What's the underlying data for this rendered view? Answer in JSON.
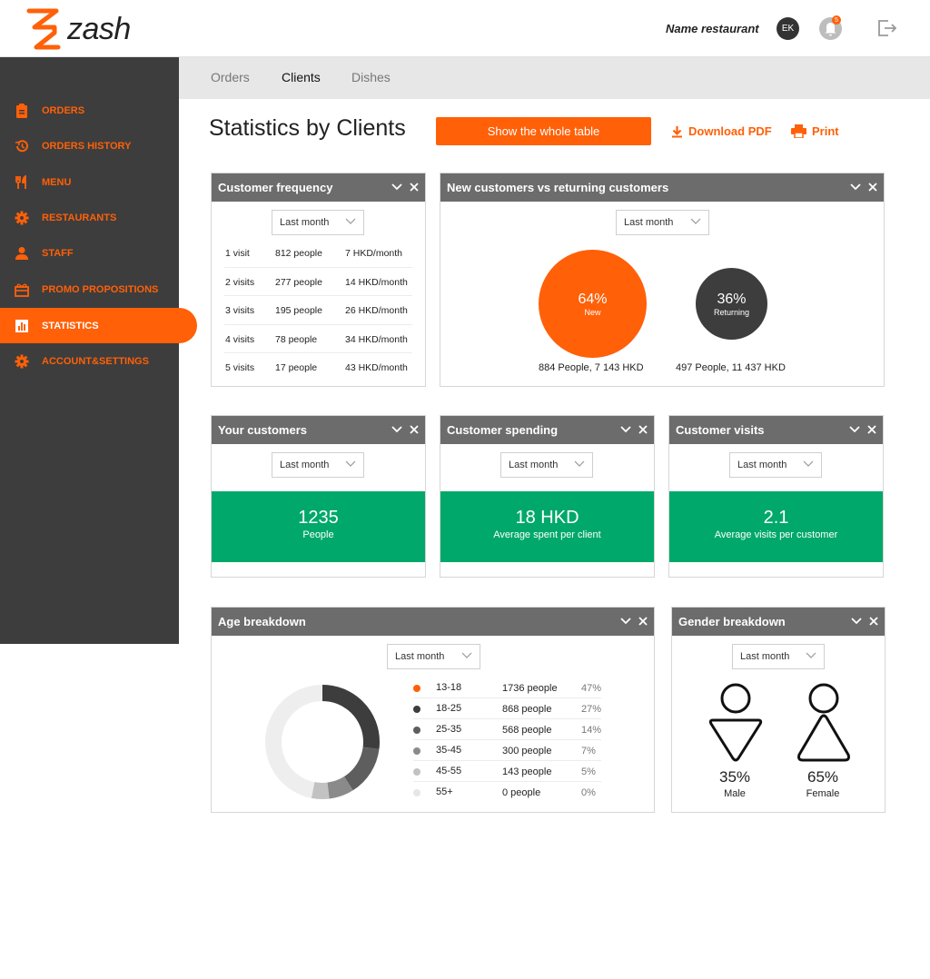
{
  "header": {
    "logo_text": "zash",
    "restaurant_name": "Name restaurant",
    "avatar_initials": "EK",
    "notification_count": "5"
  },
  "sidebar": {
    "items": [
      {
        "label": "ORDERS",
        "icon": "clipboard-icon"
      },
      {
        "label": "ORDERS HISTORY",
        "icon": "history-icon"
      },
      {
        "label": "MENU",
        "icon": "cutlery-icon"
      },
      {
        "label": "RESTAURANTS",
        "icon": "gear-icon"
      },
      {
        "label": "STAFF",
        "icon": "person-icon"
      },
      {
        "label": "PROMO PROPOSITIONS",
        "icon": "gift-icon"
      },
      {
        "label": "STATISTICS",
        "icon": "chart-icon",
        "active": true
      },
      {
        "label": "ACCOUNT&SETTINGS",
        "icon": "gear-icon"
      }
    ]
  },
  "tabs": [
    "Orders",
    "Clients",
    "Dishes"
  ],
  "active_tab": "Clients",
  "page": {
    "title": "Statistics by Clients",
    "show_table_label": "Show the whole table",
    "download_label": "Download PDF",
    "print_label": "Print"
  },
  "colors": {
    "accent": "#ff6008",
    "dark": "#3d3d3d",
    "green": "#00a86b",
    "card_head": "#6c6c6c"
  },
  "frequency": {
    "title": "Customer frequency",
    "period": "Last month",
    "rows": [
      {
        "visits": "1 visit",
        "people": "812 people",
        "spend": "7 HKD/month"
      },
      {
        "visits": "2 visits",
        "people": "277 people",
        "spend": "14 HKD/month"
      },
      {
        "visits": "3 visits",
        "people": "195 people",
        "spend": "26 HKD/month"
      },
      {
        "visits": "4 visits",
        "people": "78 people",
        "spend": "34 HKD/month"
      },
      {
        "visits": "5 visits",
        "people": "17 people",
        "spend": "43 HKD/month"
      }
    ]
  },
  "new_vs_returning": {
    "title": "New customers vs returning customers",
    "period": "Last month",
    "new": {
      "pct": "64%",
      "label": "New",
      "caption": "884 People, 7 143 HKD"
    },
    "returning": {
      "pct": "36%",
      "label": "Returning",
      "caption": "497 People, 11 437 HKD"
    }
  },
  "your_customers": {
    "title": "Your customers",
    "period": "Last month",
    "value": "1235",
    "sub": "People"
  },
  "customer_spending": {
    "title": "Customer spending",
    "period": "Last month",
    "value": "18 HKD",
    "sub": "Average spent per client"
  },
  "customer_visits": {
    "title": "Customer visits",
    "period": "Last month",
    "value": "2.1",
    "sub": "Average visits per customer"
  },
  "age": {
    "title": "Age breakdown",
    "period": "Last month",
    "rows": [
      {
        "range": "13-18",
        "people": "1736 people",
        "pct": "47%",
        "color": "#ff6008"
      },
      {
        "range": "18-25",
        "people": "868 people",
        "pct": "27%",
        "color": "#3d3d3d"
      },
      {
        "range": "25-35",
        "people": "568 people",
        "pct": "14%",
        "color": "#5e5e5e"
      },
      {
        "range": "35-45",
        "people": "300 people",
        "pct": "7%",
        "color": "#8a8a8a"
      },
      {
        "range": "45-55",
        "people": "143 people",
        "pct": "5%",
        "color": "#c2c2c2"
      },
      {
        "range": "55+",
        "people": "0 people",
        "pct": "0%",
        "color": "#e6e6e6"
      }
    ]
  },
  "chart_data": {
    "type": "pie",
    "categories": [
      "13-18",
      "18-25",
      "25-35",
      "35-45",
      "45-55",
      "55+"
    ],
    "values": [
      47,
      27,
      14,
      7,
      5,
      0
    ],
    "title": ""
  },
  "gender": {
    "title": "Gender breakdown",
    "period": "Last month",
    "male": {
      "pct": "35%",
      "label": "Male"
    },
    "female": {
      "pct": "65%",
      "label": "Female"
    }
  }
}
